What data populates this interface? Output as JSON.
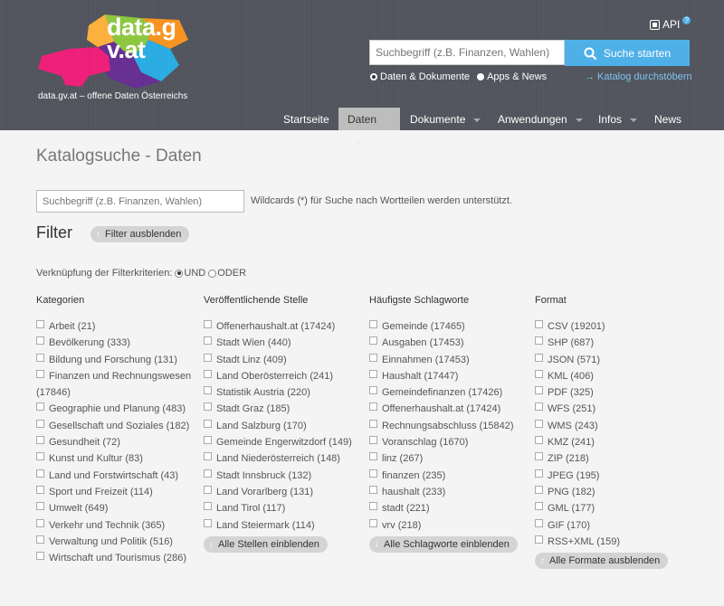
{
  "header": {
    "logo_title": "data.gv.at",
    "tagline": "data.gv.at – offene Daten Österreichs",
    "api_label": "API",
    "search_placeholder": "Suchbegriff (z.B. Finanzen, Wahlen)",
    "search_button": "Suche starten",
    "radio_data": "Daten & Dokumente",
    "radio_apps": "Apps & News",
    "catalog_link": "→ Katalog durchstöbern",
    "nav": [
      {
        "label": "Startseite"
      },
      {
        "label": "Daten"
      },
      {
        "label": "Dokumente"
      },
      {
        "label": "Anwendungen"
      },
      {
        "label": "Infos"
      },
      {
        "label": "News"
      }
    ],
    "colors": {
      "accent": "#4fb0e8",
      "header_bg": "#51545c",
      "active_tab": "#bdbdbd"
    }
  },
  "main": {
    "title": "Katalogsuche - Daten",
    "search_placeholder": "Suchbegriff (z.B. Finanzen, Wahlen)",
    "wildcard_note": "Wildcards (*) für Suche nach Wortteilen werden unterstützt.",
    "filter_heading": "Filter",
    "filter_hide": "Filter ausblenden",
    "verknuepfung": {
      "label": "Verknüpfung der Filterkriterien:",
      "und": "UND",
      "oder": "ODER"
    },
    "columns": {
      "kategorien": {
        "heading": "Kategorien",
        "items": [
          "Arbeit (21)",
          "Bevölkerung (333)",
          "Bildung und Forschung (131)",
          "Finanzen und Rechnungswesen (17846)",
          "Geographie und Planung (483)",
          "Gesellschaft und Soziales (182)",
          "Gesundheit (72)",
          "Kunst und Kultur (83)",
          "Land und Forstwirtschaft (43)",
          "Sport und Freizeit (114)",
          "Umwelt (649)",
          "Verkehr und Technik (365)",
          "Verwaltung und Politik (516)",
          "Wirtschaft und Tourismus (286)"
        ]
      },
      "stellen": {
        "heading": "Veröffentlichende Stelle",
        "items": [
          "Offenerhaushalt.at (17424)",
          "Stadt Wien (440)",
          "Stadt Linz (409)",
          "Land Oberösterreich (241)",
          "Statistik Austria (220)",
          "Stadt Graz (185)",
          "Land Salzburg (170)",
          "Gemeinde Engerwitzdorf (149)",
          "Land Niederösterreich (148)",
          "Stadt Innsbruck (132)",
          "Land Vorarlberg (131)",
          "Land Tirol (117)",
          "Land Steiermark (114)"
        ],
        "button": "Alle Stellen einblenden"
      },
      "schlagworte": {
        "heading": "Häufigste Schlagworte",
        "items": [
          "Gemeinde (17465)",
          "Ausgaben (17453)",
          "Einnahmen (17453)",
          "Haushalt (17447)",
          "Gemeindefinanzen (17426)",
          "Offenerhaushalt.at (17424)",
          "Rechnungsabschluss (15842)",
          "Voranschlag (1670)",
          "linz (267)",
          "finanzen (235)",
          "haushalt (233)",
          "stadt (221)",
          "vrv (218)"
        ],
        "button": "Alle Schlagworte einblenden"
      },
      "format": {
        "heading": "Format",
        "items": [
          "CSV (19201)",
          "SHP (687)",
          "JSON (571)",
          "KML (406)",
          "PDF (325)",
          "WFS (251)",
          "WMS (243)",
          "KMZ (241)",
          "ZIP (218)",
          "JPEG (195)",
          "PNG (182)",
          "GML (177)",
          "GIF (170)",
          "RSS+XML (159)"
        ],
        "button": "Alle Formate ausblenden"
      }
    }
  }
}
